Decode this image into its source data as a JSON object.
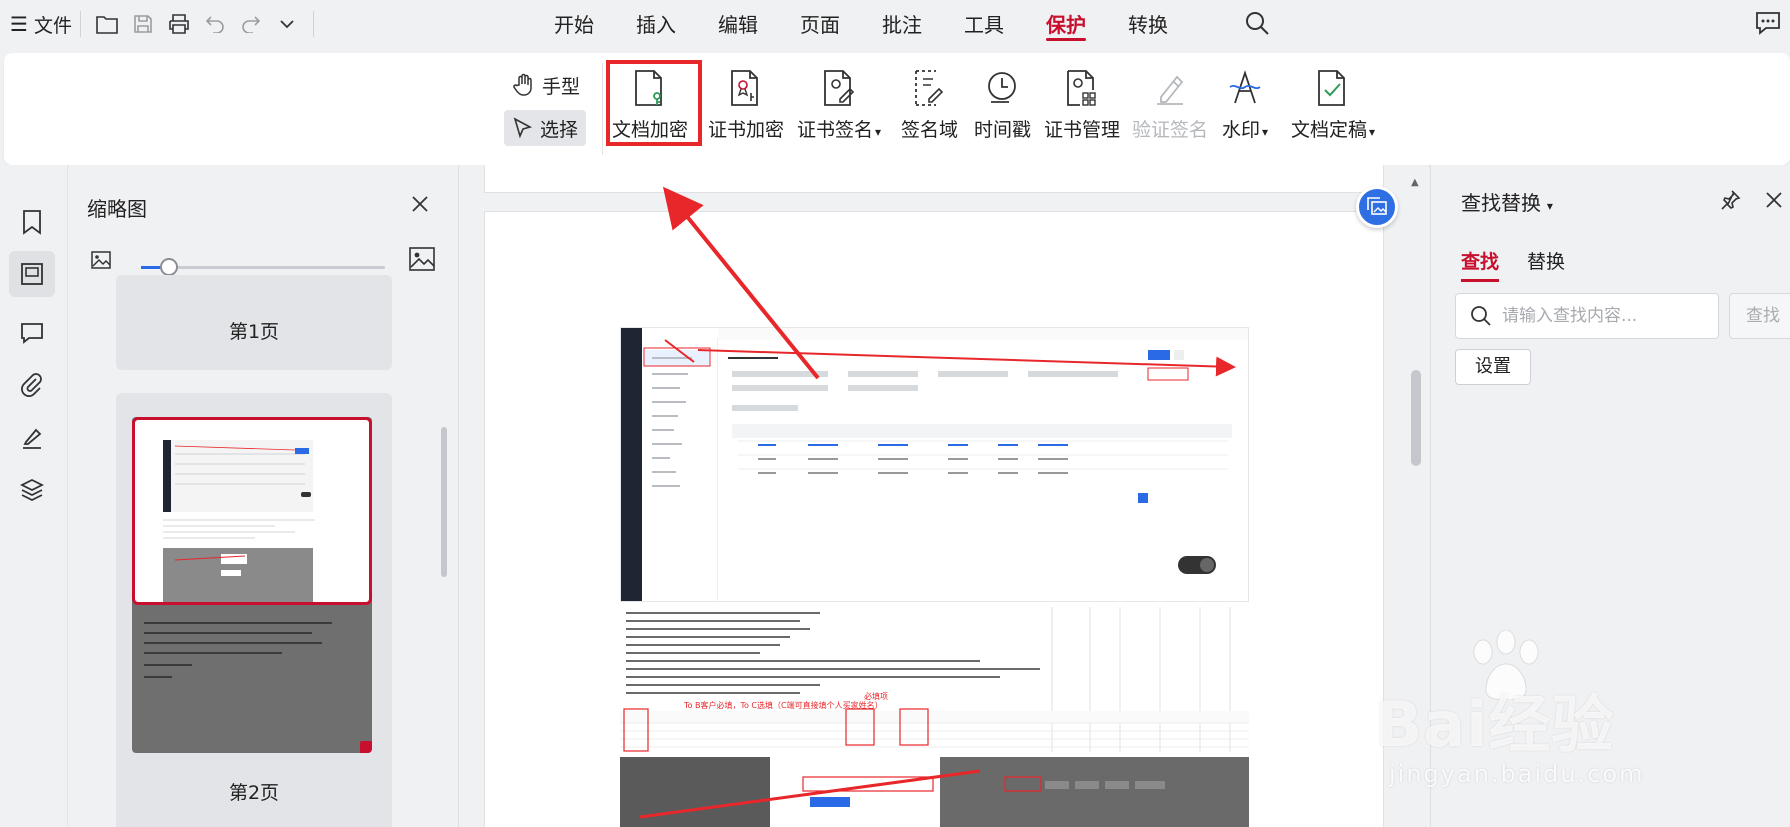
{
  "menubar": {
    "file_label": "文件",
    "tabs": [
      "开始",
      "插入",
      "编辑",
      "页面",
      "批注",
      "工具",
      "保护",
      "转换"
    ],
    "active_tab": "保护"
  },
  "ribbon": {
    "hand_label": "手型",
    "select_label": "选择",
    "buttons": [
      {
        "label": "文档加密",
        "icon": "doc-lock-icon"
      },
      {
        "label": "证书加密",
        "icon": "cert-encrypt-icon"
      },
      {
        "label": "证书签名",
        "icon": "cert-sign-icon"
      },
      {
        "label": "签名域",
        "icon": "sign-field-icon"
      },
      {
        "label": "时间戳",
        "icon": "timestamp-icon"
      },
      {
        "label": "证书管理",
        "icon": "cert-manage-icon"
      },
      {
        "label": "验证签名",
        "icon": "verify-sign-icon"
      },
      {
        "label": "水印",
        "icon": "watermark-icon"
      },
      {
        "label": "文档定稿",
        "icon": "finalize-icon"
      }
    ]
  },
  "thumbnails": {
    "title": "缩略图",
    "zoom_percent": 12,
    "pages": [
      "第1页",
      "第2页"
    ]
  },
  "document": {
    "red_note_1": "To B客户必填，To C选填（C端可直接填个人买家姓名）",
    "red_note_2": "必填项"
  },
  "find_panel": {
    "title": "查找替换",
    "tab_find": "查找",
    "tab_replace": "替换",
    "placeholder": "请输入查找内容...",
    "find_button": "查找",
    "settings_button": "设置"
  },
  "watermark": {
    "brand": "Bai经验",
    "url": "jingyan.baidu.com"
  },
  "colors": {
    "accent": "#c8102e",
    "highlight": "#e8272b",
    "slider": "#2b6ae6"
  }
}
